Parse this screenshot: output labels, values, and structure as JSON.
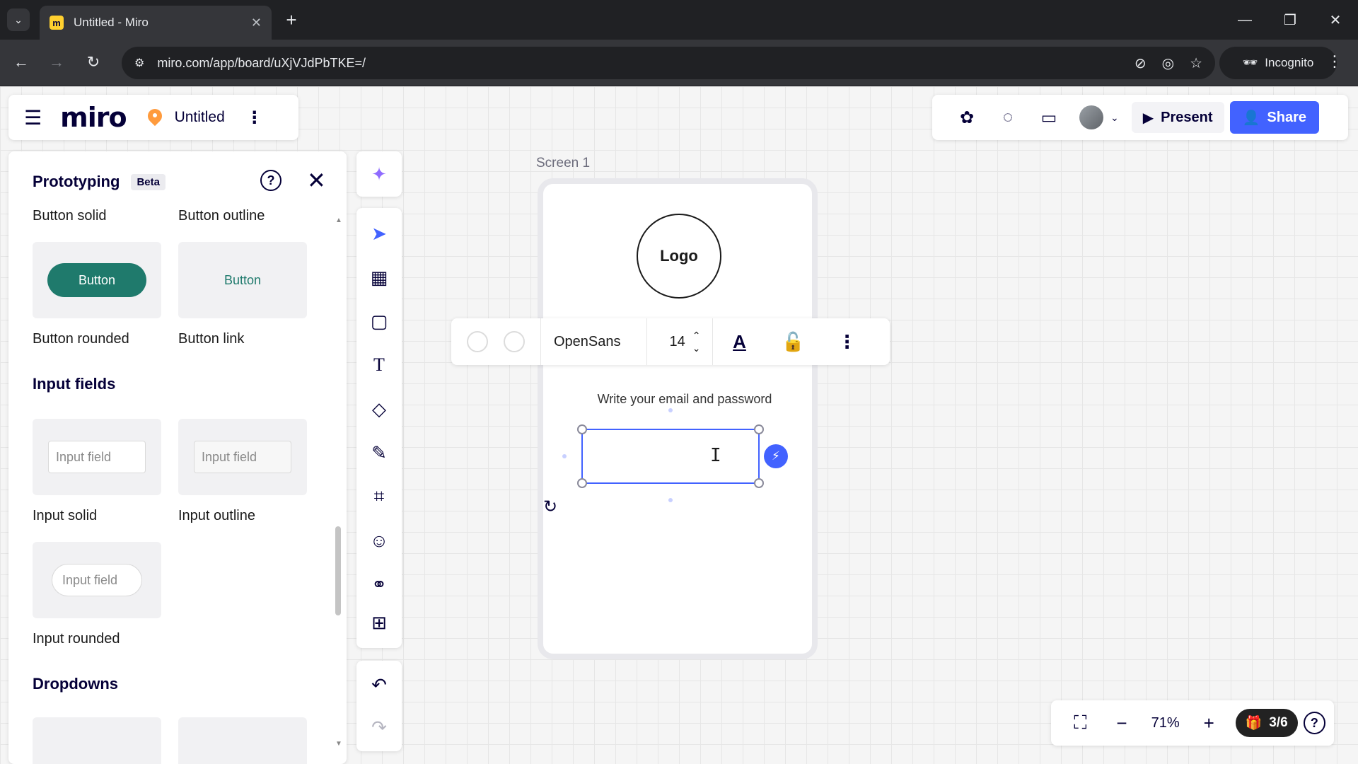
{
  "browser": {
    "tab_title": "Untitled - Miro",
    "url": "miro.com/app/board/uXjVJdPbTKE=/",
    "incognito_label": "Incognito"
  },
  "board": {
    "logo": "miro",
    "name": "Untitled"
  },
  "collab": {
    "present_label": "Present",
    "share_label": "Share"
  },
  "prototyping_panel": {
    "title": "Prototyping",
    "badge": "Beta",
    "items": {
      "button_solid": "Button solid",
      "button_outline": "Button outline",
      "button_rounded": "Button rounded",
      "button_link": "Button link",
      "button_sample": "Button",
      "input_section": "Input fields",
      "input_sample": "Input field",
      "input_solid": "Input solid",
      "input_outline": "Input outline",
      "input_rounded": "Input rounded",
      "dropdown_section": "Dropdowns"
    }
  },
  "frame": {
    "label": "Screen 1",
    "logo_text": "Logo",
    "prompt_text": "Write your email and password"
  },
  "context_toolbar": {
    "font": "OpenSans",
    "font_size": "14"
  },
  "zoom_bar": {
    "zoom": "71%",
    "gift_count": "3/6"
  },
  "colors": {
    "accent": "#4262ff",
    "brand_dark": "#050038",
    "button_green": "#1f7a6c"
  }
}
